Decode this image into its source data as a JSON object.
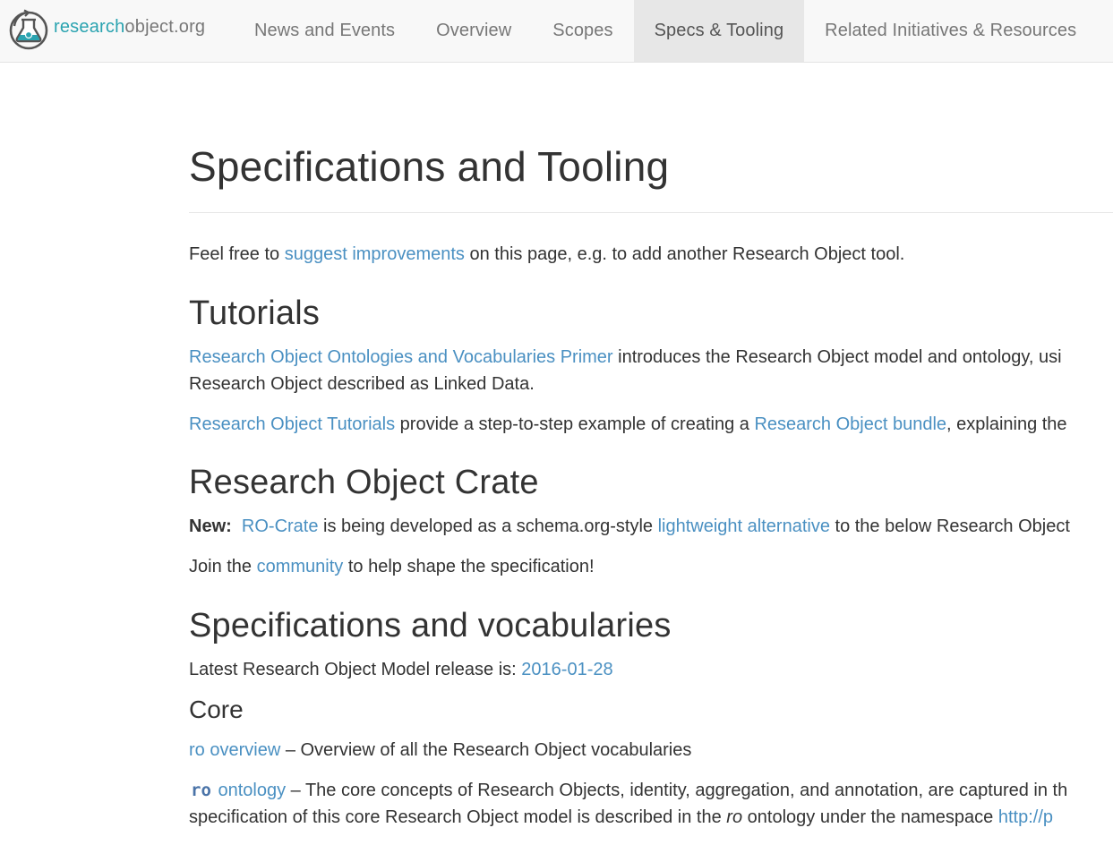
{
  "brand": {
    "part_a": "research",
    "part_b": "object.org"
  },
  "nav": {
    "items": [
      {
        "label": "News and Events"
      },
      {
        "label": "Overview"
      },
      {
        "label": "Scopes"
      },
      {
        "label": "Specs & Tooling",
        "active": true
      },
      {
        "label": "Related Initiatives & Resources"
      }
    ]
  },
  "page": {
    "title": "Specifications and Tooling"
  },
  "intro": {
    "before": "Feel free to ",
    "link": "suggest improvements",
    "after": " on this page, e.g. to add another Research Object tool."
  },
  "tutorials": {
    "heading": "Tutorials",
    "p1": {
      "link": "Research Object Ontologies and Vocabularies Primer",
      "after": " introduces the Research Object model and ontology, usi",
      "line2": "Research Object described as Linked Data."
    },
    "p2": {
      "link1": "Research Object Tutorials",
      "mid": " provide a step-to-step example of creating a ",
      "link2": "Research Object bundle",
      "after": ", explaining the"
    }
  },
  "crate": {
    "heading": "Research Object Crate",
    "new_label": "New:",
    "p1": {
      "link1": "RO-Crate",
      "mid": " is being developed as a schema.org-style ",
      "link2": "lightweight alternative",
      "after": " to the below Research Object"
    },
    "p2": {
      "before": "Join the ",
      "link": "community",
      "after": " to help shape the specification!"
    }
  },
  "specs": {
    "heading": "Specifications and vocabularies",
    "release": {
      "before": "Latest Research Object Model release is: ",
      "link": "2016-01-28"
    },
    "core": {
      "heading": "Core",
      "overview": {
        "link": "ro overview",
        "after": " – Overview of all the Research Object vocabularies"
      },
      "ontology": {
        "code": "ro",
        "link": "ontology",
        "after": " – The core concepts of Research Objects, identity, aggregation, and annotation, are captured in th",
        "line2_before": "specification of this core Research Object model is described in the ",
        "line2_em": "ro",
        "line2_mid": " ontology under the namespace ",
        "line2_link": "http://p"
      }
    }
  }
}
